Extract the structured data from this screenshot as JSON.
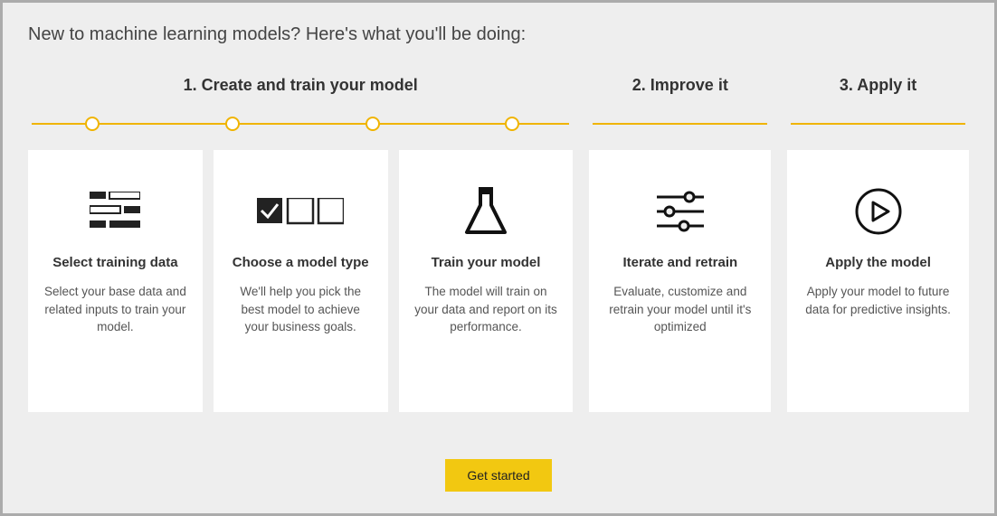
{
  "heading": "New to machine learning models? Here's what you'll be doing:",
  "stages": {
    "create": {
      "label": "1. Create and train your model"
    },
    "improve": {
      "label": "2. Improve it"
    },
    "apply": {
      "label": "3. Apply it"
    }
  },
  "cards": {
    "select_data": {
      "title": "Select training data",
      "desc": "Select your base data and related inputs to train your model."
    },
    "choose_model": {
      "title": "Choose a model type",
      "desc": "We'll help you pick the best model to achieve your business goals."
    },
    "train": {
      "title": "Train your model",
      "desc": "The model will train on your data and report on its performance."
    },
    "iterate": {
      "title": "Iterate and retrain",
      "desc": "Evaluate, customize and retrain your model until it's optimized"
    },
    "apply": {
      "title": "Apply the model",
      "desc": "Apply your model to future data for predictive insights."
    }
  },
  "button": {
    "get_started": "Get started"
  },
  "colors": {
    "accent": "#f2c811",
    "line": "#f0b400"
  }
}
